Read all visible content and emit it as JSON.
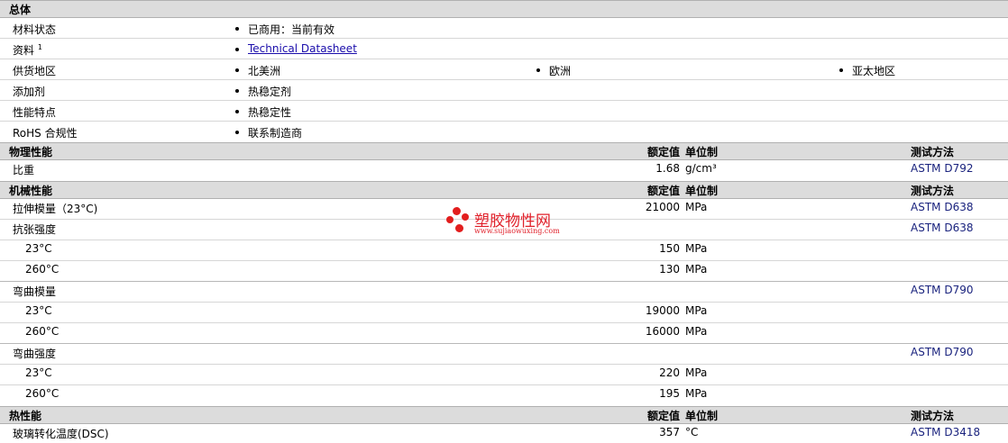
{
  "general": {
    "title": "总体",
    "rows": [
      {
        "label": "材料状态",
        "values": [
          "已商用：当前有效"
        ]
      },
      {
        "label": "资料",
        "footnote": "1",
        "link": "Technical Datasheet"
      },
      {
        "label": "供货地区",
        "values": [
          "北美洲",
          "欧洲",
          "亚太地区"
        ]
      },
      {
        "label": "添加剂",
        "values": [
          "热稳定剂"
        ]
      },
      {
        "label": "性能特点",
        "values": [
          "热稳定性"
        ]
      },
      {
        "label": "RoHS 合规性",
        "values": [
          "联系制造商"
        ]
      }
    ]
  },
  "physical": {
    "title": "物理性能",
    "value_header": "额定值",
    "unit_header": "单位制",
    "method_header": "测试方法",
    "rows": [
      {
        "label": "比重",
        "value": "1.68",
        "unit": "g/cm³",
        "method": "ASTM D792"
      }
    ]
  },
  "mechanical": {
    "title": "机械性能",
    "value_header": "额定值",
    "unit_header": "单位制",
    "method_header": "测试方法",
    "tensile_modulus": {
      "label": "拉伸模量（23°C)",
      "value": "21000",
      "unit": "MPa",
      "method": "ASTM D638"
    },
    "tensile_strength": {
      "label": "抗张强度",
      "method": "ASTM D638",
      "rows": [
        {
          "label": "23°C",
          "value": "150",
          "unit": "MPa"
        },
        {
          "label": "260°C",
          "value": "130",
          "unit": "MPa"
        }
      ]
    },
    "flexural_modulus": {
      "label": "弯曲模量",
      "method": "ASTM D790",
      "rows": [
        {
          "label": "23°C",
          "value": "19000",
          "unit": "MPa"
        },
        {
          "label": "260°C",
          "value": "16000",
          "unit": "MPa"
        }
      ]
    },
    "flexural_strength": {
      "label": "弯曲强度",
      "method": "ASTM D790",
      "rows": [
        {
          "label": "23°C",
          "value": "220",
          "unit": "MPa"
        },
        {
          "label": "260°C",
          "value": "195",
          "unit": "MPa"
        }
      ]
    }
  },
  "thermal": {
    "title": "热性能",
    "value_header": "额定值",
    "unit_header": "单位制",
    "method_header": "测试方法",
    "rows": [
      {
        "label": "玻璃转化温度(DSC)",
        "value": "357",
        "unit": "°C",
        "method": "ASTM D3418"
      }
    ]
  },
  "watermark": {
    "title": "塑胶物性网",
    "url": "www.sujiaowuxing.com",
    "color": "#e21e1e"
  }
}
